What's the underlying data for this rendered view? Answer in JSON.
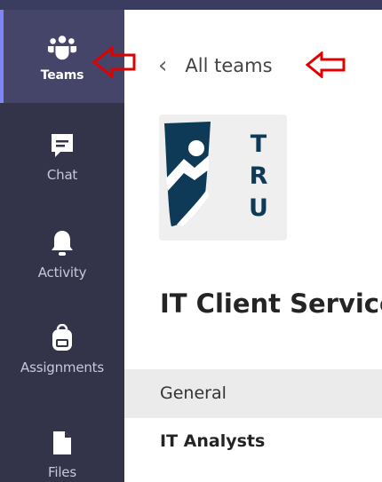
{
  "rail": {
    "items": [
      {
        "label": "Teams",
        "icon": "teams-icon",
        "active": true
      },
      {
        "label": "Chat",
        "icon": "chat-icon"
      },
      {
        "label": "Activity",
        "icon": "bell-icon"
      },
      {
        "label": "Assignments",
        "icon": "backpack-icon"
      },
      {
        "label": "Files",
        "icon": "file-icon"
      }
    ]
  },
  "header": {
    "back_label": "All teams",
    "chevron": "‹"
  },
  "team": {
    "logo_letters": [
      "T",
      "R",
      "U"
    ],
    "name": "IT Client Services"
  },
  "channels": [
    {
      "name": "General",
      "selected": true
    },
    {
      "name": "IT Analysts",
      "selected": false
    }
  ],
  "colors": {
    "rail": "#33344a",
    "rail_active": "#444569",
    "annotation": "#e00000",
    "logo_navy": "#0e3a57"
  }
}
